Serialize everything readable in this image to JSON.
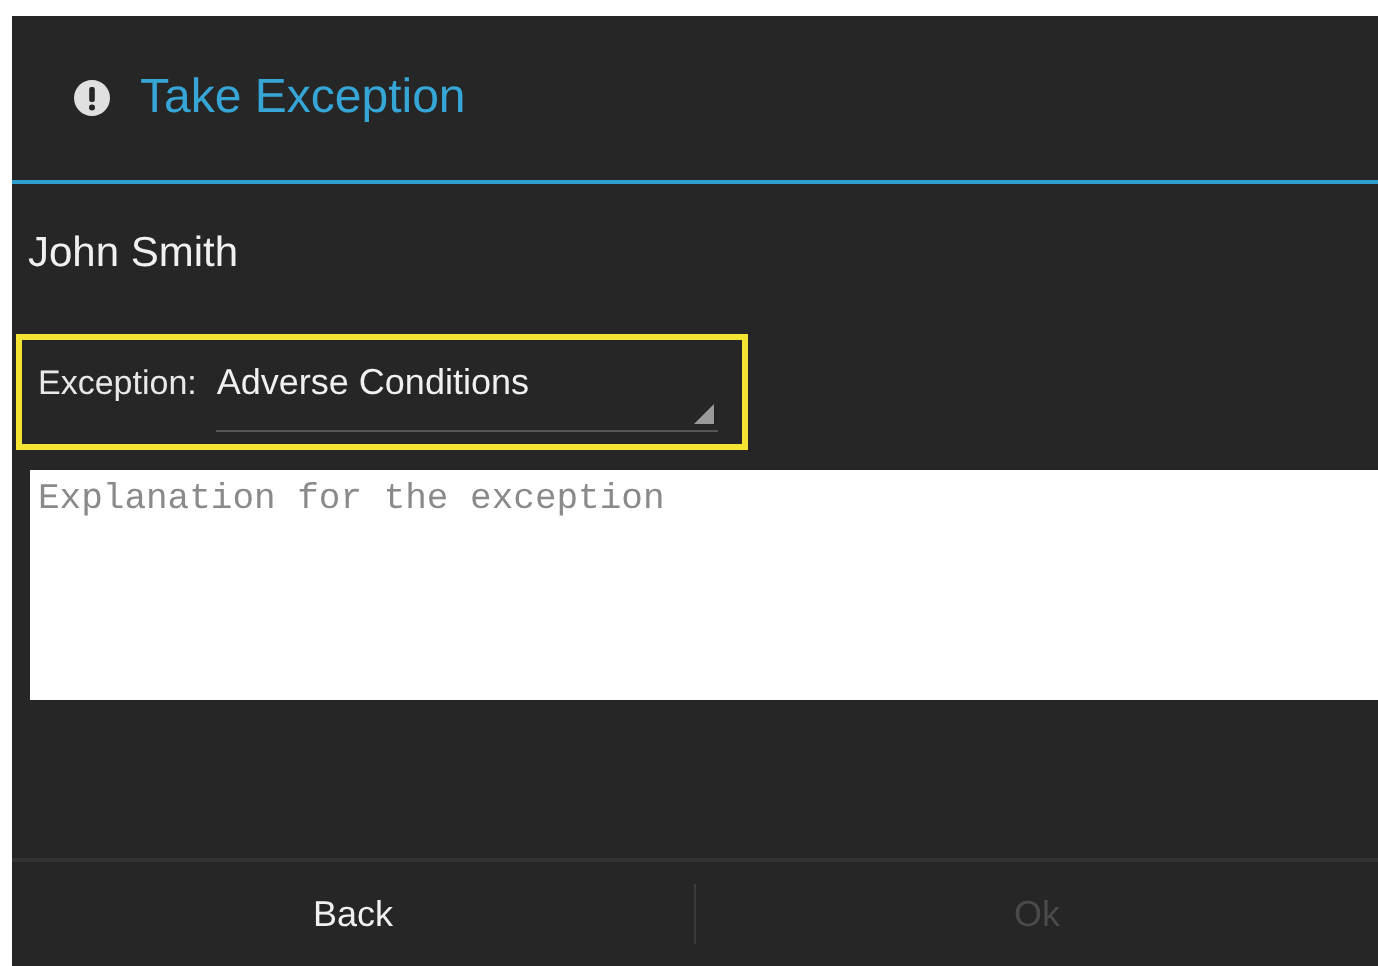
{
  "dialog": {
    "title": "Take Exception"
  },
  "name": "John Smith",
  "exception": {
    "label": "Exception:",
    "value": "Adverse Conditions",
    "highlighted": true
  },
  "explanation": {
    "placeholder": "Explanation for the exception"
  },
  "buttons": [
    {
      "label": "Back",
      "disabled": false
    },
    {
      "label": "Ok",
      "disabled": true
    }
  ]
}
